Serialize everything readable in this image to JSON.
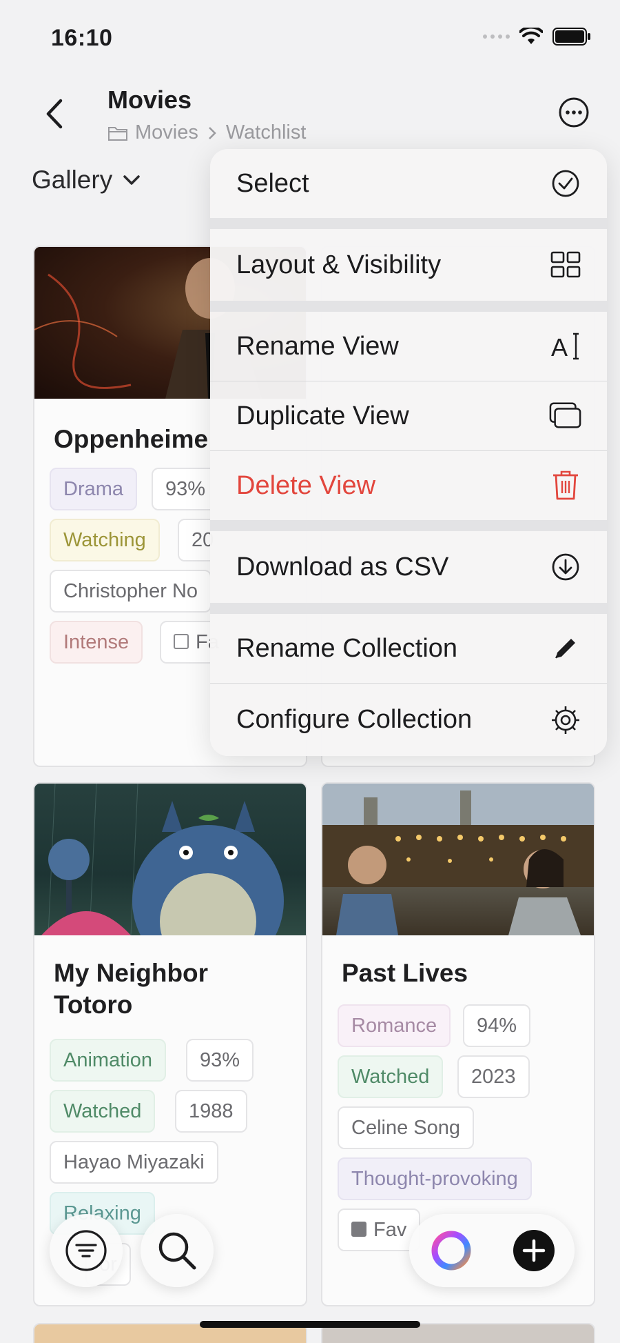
{
  "status_bar": {
    "time": "16:10"
  },
  "header": {
    "title": "Movies",
    "breadcrumb": [
      "Movies",
      "Watchlist"
    ]
  },
  "view": {
    "label": "Gallery"
  },
  "menu": {
    "items": [
      {
        "label": "Select",
        "icon": "check-circle-icon"
      },
      {
        "label": "Layout & Visibility",
        "icon": "grid-icon"
      },
      {
        "label": "Rename View",
        "icon": "text-cursor-icon"
      },
      {
        "label": "Duplicate View",
        "icon": "duplicate-icon"
      },
      {
        "label": "Delete View",
        "icon": "trash-icon"
      },
      {
        "label": "Download as CSV",
        "icon": "download-icon"
      },
      {
        "label": "Rename Collection",
        "icon": "pencil-icon"
      },
      {
        "label": "Configure Collection",
        "icon": "gear-icon"
      }
    ],
    "danger_color": "#e2463d"
  },
  "cards": [
    {
      "title": "Oppenheime",
      "tags": [
        "Drama",
        "93%",
        "Watching",
        "20",
        "Christopher No",
        "Intense",
        "Fa"
      ],
      "favorite_checked": false
    },
    {
      "title_line1": "My Neighbor",
      "title_line2": "Totoro",
      "tags": [
        "Animation",
        "93%",
        "Watched",
        "1988",
        "Hayao Miyazaki",
        "Relaxing",
        "or"
      ]
    },
    {
      "title": "Past Lives",
      "tags": [
        "Romance",
        "94%",
        "Watched",
        "2023",
        "Celine Song",
        "Thought-provoking",
        "Fav"
      ],
      "favorite_checked": true
    }
  ],
  "bottom_bar": {
    "filter_icon": "filter-icon",
    "search_icon": "search-icon",
    "ai_icon": "ai-ring-icon",
    "add_icon": "plus-icon"
  }
}
